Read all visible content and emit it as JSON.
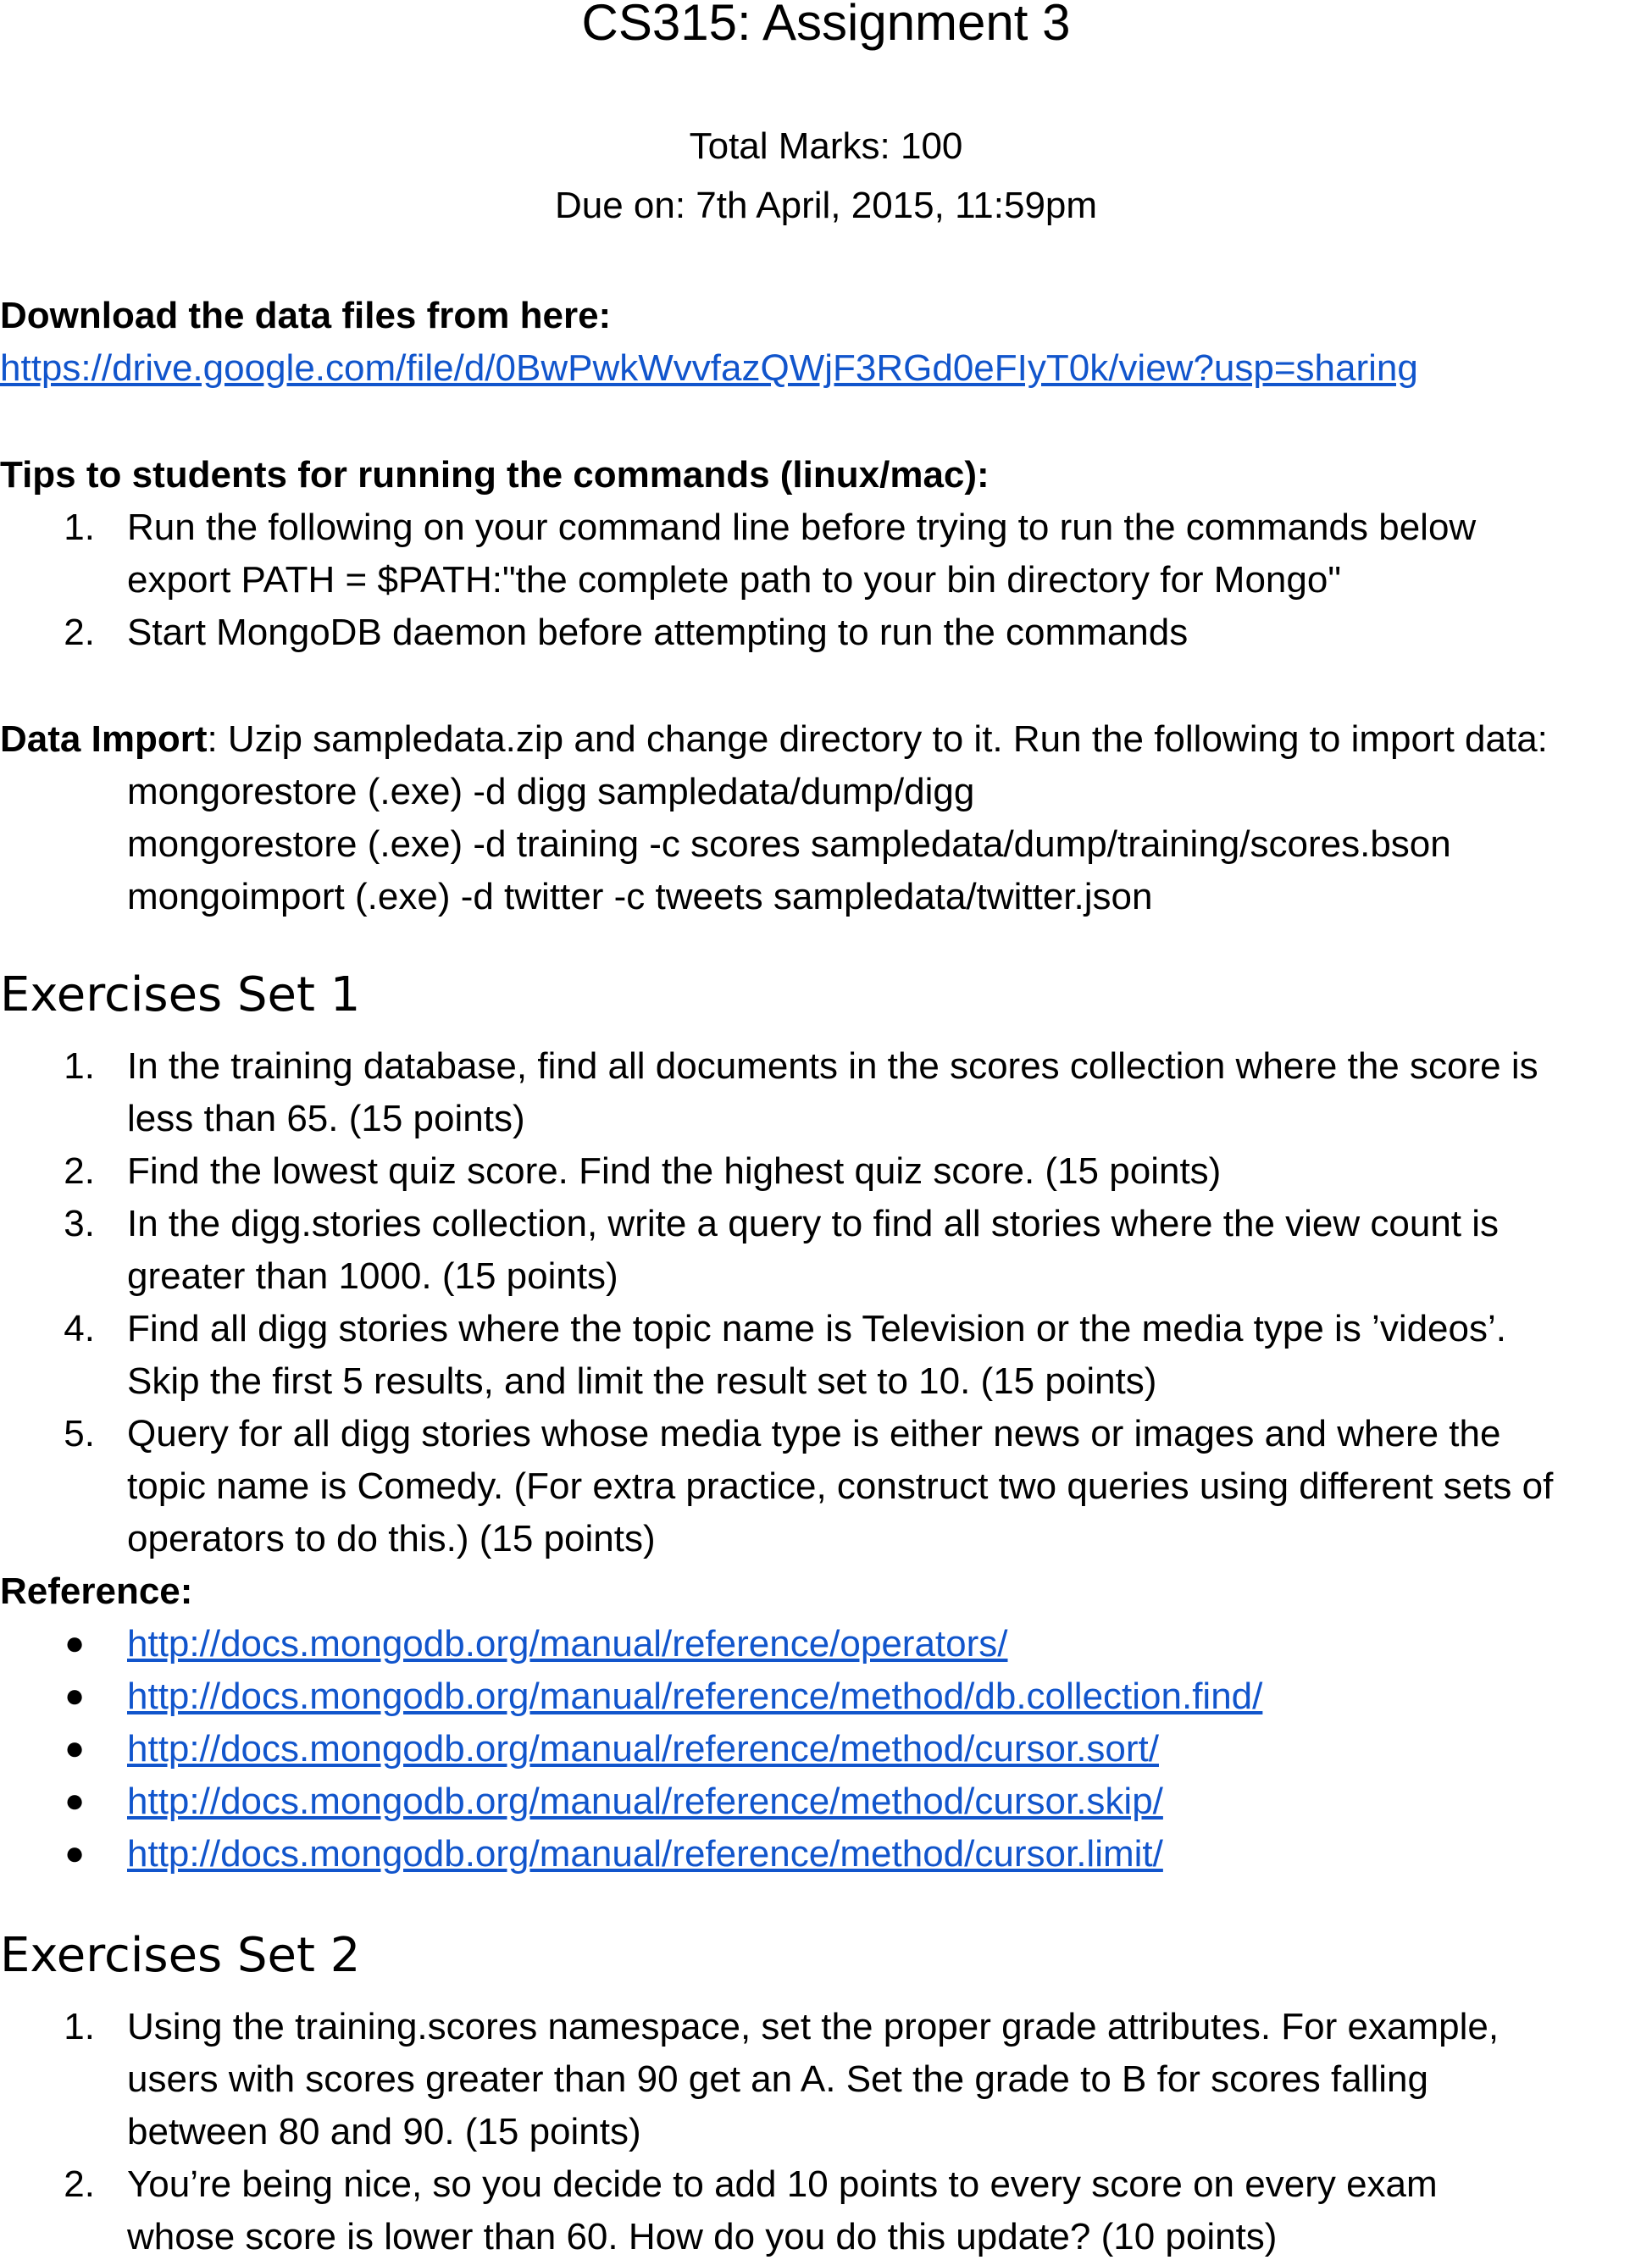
{
  "doc": {
    "title": "CS315: Assignment 3",
    "total_marks": "Total Marks: 100",
    "due": "Due on: 7th April, 2015, 11:59pm"
  },
  "download": {
    "heading": "Download the data files from here:",
    "url": "https://drive.google.com/file/d/0BwPwkWvvfazQWjF3RGd0eFIyT0k/view?usp=sharing"
  },
  "tips": {
    "heading": "Tips to students for running the commands (linux/mac):",
    "items": [
      {
        "num": "1.",
        "line1": "Run the following on your command line before trying to run the commands below",
        "line2": "export PATH = $PATH:\"the complete path to your bin directory for Mongo\""
      },
      {
        "num": "2.",
        "line1": "Start MongoDB daemon before attempting to run the commands"
      }
    ]
  },
  "data_import": {
    "label": "Data Import",
    "text": ": Uzip sampledata.zip and change directory to it. Run the following to import data:",
    "commands": [
      "mongorestore (.exe) -d digg sampledata/dump/digg",
      "mongorestore (.exe) -d training -c scores sampledata/dump/training/scores.bson",
      "mongoimport (.exe) -d twitter -c tweets sampledata/twitter.json"
    ]
  },
  "set1": {
    "heading": "Exercises Set 1",
    "items": [
      {
        "num": "1.",
        "lines": [
          "In the training database, find all documents in the scores collection where the score is",
          "less than 65. (15 points)"
        ]
      },
      {
        "num": "2.",
        "lines": [
          "Find the lowest quiz score. Find the highest quiz score. (15 points)"
        ]
      },
      {
        "num": "3.",
        "lines": [
          "In the digg.stories collection, write a query to find all stories where the view count is",
          "greater than 1000. (15 points)"
        ]
      },
      {
        "num": "4.",
        "lines": [
          "Find all digg stories where the topic name is Television or the media type is ’videos’.",
          "Skip the first 5 results, and limit the result set to 10. (15 points)"
        ]
      },
      {
        "num": "5.",
        "lines": [
          "Query for all digg stories whose media type is either news or images and where the",
          "topic name is Comedy. (For extra practice, construct two queries using different sets of",
          "operators to do this.) (15 points)"
        ]
      }
    ]
  },
  "reference": {
    "heading": "Reference:",
    "bullet": "●",
    "links": [
      "http://docs.mongodb.org/manual/reference/operators/",
      "http://docs.mongodb.org/manual/reference/method/db.collection.find/",
      "http://docs.mongodb.org/manual/reference/method/cursor.sort/",
      "http://docs.mongodb.org/manual/reference/method/cursor.skip/",
      "http://docs.mongodb.org/manual/reference/method/cursor.limit/"
    ]
  },
  "set2": {
    "heading": "Exercises Set 2",
    "items": [
      {
        "num": "1.",
        "lines": [
          "Using the training.scores namespace, set the proper grade attributes. For example,",
          "users with scores greater than 90 get an A. Set the grade to B for scores falling",
          "between 80 and 90. (15 points)"
        ]
      },
      {
        "num": "2.",
        "lines": [
          "You’re being nice, so you decide to add 10 points to every score on every exam",
          "whose score is lower than 60. How do you do this update? (10 points)"
        ]
      }
    ]
  }
}
